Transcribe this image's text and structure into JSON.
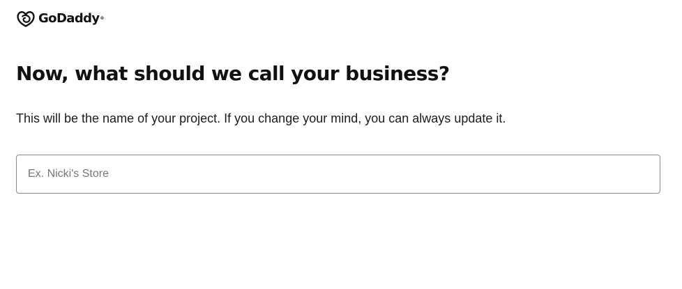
{
  "brand": {
    "name": "GoDaddy",
    "trademark": "®",
    "icon": "godaddy-logo-icon"
  },
  "main": {
    "title": "Now, what should we call your business?",
    "subtitle": "This will be the name of your project. If you change your mind, you can always update it.",
    "business_name_field": {
      "value": "",
      "placeholder": "Ex. Nicki's Store"
    }
  },
  "colors": {
    "text": "#111111",
    "border": "#8a8a8a",
    "placeholder": "#767676",
    "background": "#ffffff"
  }
}
